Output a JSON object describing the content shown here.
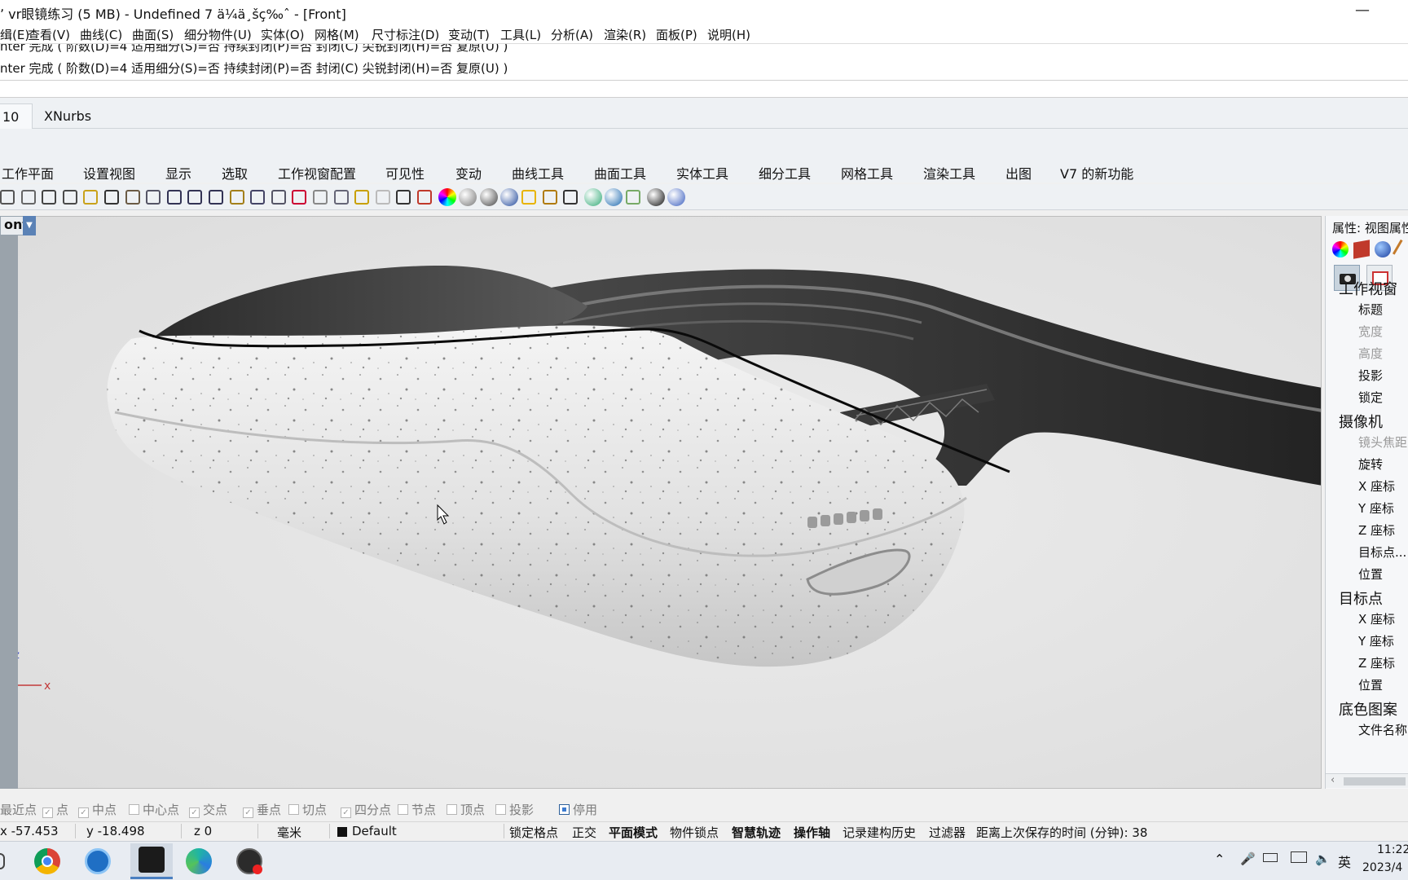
{
  "window": {
    "title": "ʼ vr眼镜练习 (5 MB) - Undefined 7 ä¼ä¸šç‰ˆ - [Front]",
    "minimize": "—",
    "close": "✕"
  },
  "menu": [
    "缉(E)",
    "查看(V)",
    "曲线(C)",
    "曲面(S)",
    "细分物件(U)",
    "实体(O)",
    "网格(M)",
    "尺寸标注(D)",
    "变动(T)",
    "工具(L)",
    "分析(A)",
    "渲染(R)",
    "面板(P)",
    "说明(H)"
  ],
  "command_history": [
    "nter 完成 ( 阶数(D)=4  适用细分(S)=否  持续封闭(P)=否  封闭(C)  尖锐封闭(H)=否  复原(U) )",
    "nter 完成 ( 阶数(D)=4  适用细分(S)=否  持续封闭(P)=否  封闭(C)  尖锐封闭(H)=否  复原(U) )"
  ],
  "tabs": [
    "10",
    "XNurbs"
  ],
  "ribbon_tabs": [
    "工作平面",
    "设置视图",
    "显示",
    "选取",
    "工作视窗配置",
    "可见性",
    "变动",
    "曲线工具",
    "曲面工具",
    "实体工具",
    "细分工具",
    "网格工具",
    "渲染工具",
    "出图",
    "V7 的新功能"
  ],
  "toolbar_icons": [
    "print-icon",
    "new-icon",
    "cut-icon",
    "copy-icon",
    "paste-icon",
    "undo-icon",
    "pan-icon",
    "rotate-view-icon",
    "zoom-icon",
    "zoom-window-icon",
    "zoom-extents-icon",
    "zoom-selected-icon",
    "undo-view-icon",
    "four-viewports-icon",
    "car-icon",
    "hide-icon",
    "named-view-icon",
    "points-icon",
    "light-icon",
    "lock-icon",
    "layer-icon",
    "color-wheel-icon",
    "shaded-icon",
    "render-icon",
    "material-icon",
    "flag-icon",
    "gear-icon",
    "transform-icon",
    "globe-icon",
    "cycle-icon",
    "pin-icon",
    "zebra-icon",
    "help-icon"
  ],
  "viewport": {
    "label": "ont",
    "axis_z": "z",
    "axis_x": "x"
  },
  "properties_panel": {
    "header": "属性: 视图属性",
    "sections": [
      {
        "title": "工作视窗",
        "rows": [
          {
            "label": "标题",
            "dim": false
          },
          {
            "label": "宽度",
            "dim": true
          },
          {
            "label": "高度",
            "dim": true
          },
          {
            "label": "投影",
            "dim": false
          },
          {
            "label": "锁定",
            "dim": false
          }
        ]
      },
      {
        "title": "摄像机",
        "rows": [
          {
            "label": "镜头焦距",
            "dim": true
          },
          {
            "label": "旋转",
            "dim": false
          },
          {
            "label": "X 座标",
            "dim": false
          },
          {
            "label": "Y 座标",
            "dim": false
          },
          {
            "label": "Z 座标",
            "dim": false
          },
          {
            "label": "目标点...",
            "dim": false
          },
          {
            "label": "位置",
            "dim": false
          }
        ]
      },
      {
        "title": "目标点",
        "rows": [
          {
            "label": "X 座标",
            "dim": false
          },
          {
            "label": "Y 座标",
            "dim": false
          },
          {
            "label": "Z 座标",
            "dim": false
          },
          {
            "label": "位置",
            "dim": false
          }
        ]
      },
      {
        "title": "底色图案",
        "rows": [
          {
            "label": "文件名称",
            "dim": false
          }
        ]
      }
    ]
  },
  "osnap": [
    {
      "label": "最近点",
      "checked": null
    },
    {
      "label": "点",
      "checked": true
    },
    {
      "label": "中点",
      "checked": true
    },
    {
      "label": "中心点",
      "checked": false
    },
    {
      "label": "交点",
      "checked": true
    },
    {
      "label": "垂点",
      "checked": true
    },
    {
      "label": "切点",
      "checked": false
    },
    {
      "label": "四分点",
      "checked": true
    },
    {
      "label": "节点",
      "checked": false
    },
    {
      "label": "顶点",
      "checked": false
    },
    {
      "label": "投影",
      "checked": false
    }
  ],
  "osnap_disable": "停用",
  "status": {
    "x": "x -57.453",
    "y": "y -18.498",
    "z": "z 0",
    "unit": "毫米",
    "layer": "Default",
    "items": [
      "锁定格点",
      "正交",
      "平面模式",
      "物件锁点",
      "智慧轨迹",
      "操作轴",
      "记录建构历史",
      "过滤器",
      "距离上次保存的时间 (分钟): 38"
    ]
  },
  "taskbar": {
    "apps": [
      "chrome-icon",
      "settings-app-icon",
      "rhino-icon",
      "edge-icon",
      "obs-icon"
    ],
    "ime": "英",
    "time": "11:22",
    "date": "2023/4"
  }
}
